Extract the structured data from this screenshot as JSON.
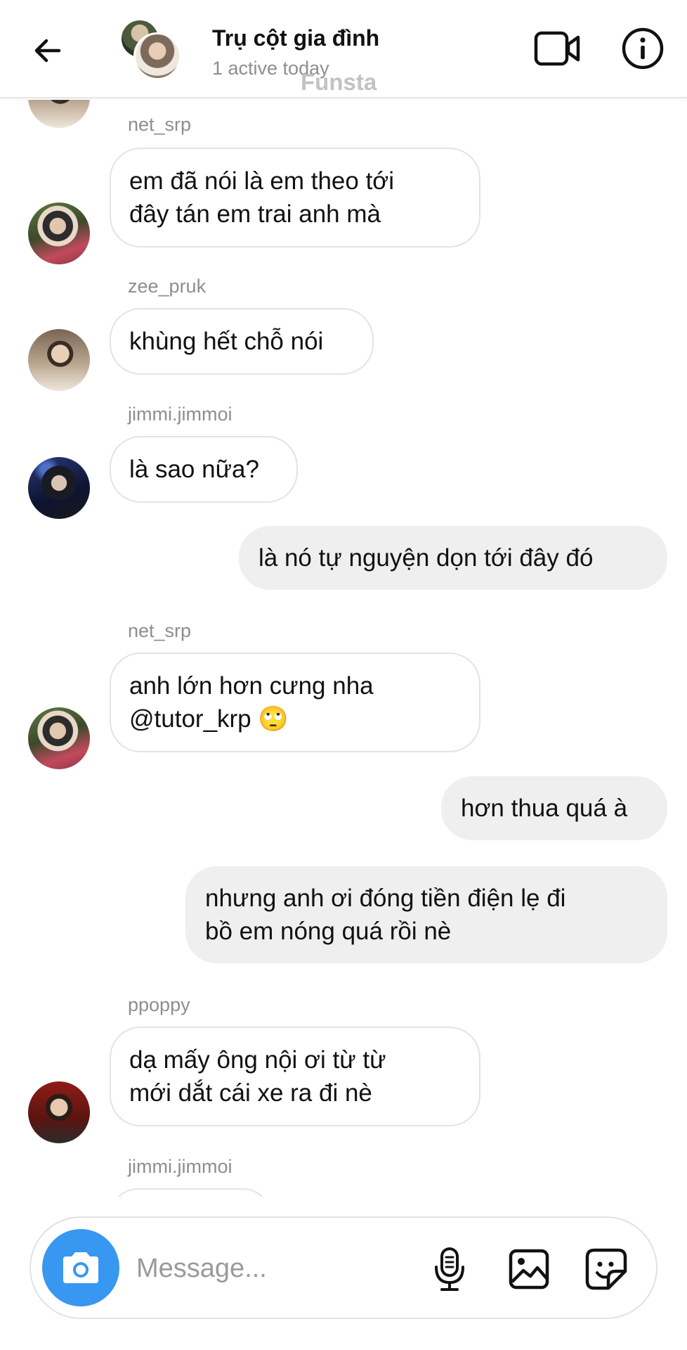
{
  "header": {
    "title": "Trụ cột gia đình",
    "status": "1 active today",
    "watermark": "Funsta",
    "icons": [
      "back-arrow-icon",
      "video-call-icon",
      "info-icon"
    ]
  },
  "messages": [
    {
      "direction": "in",
      "sender": "net_srp",
      "text": "em đã nói là em theo tới\nđây tán em trai anh mà",
      "avatar": "net_srp"
    },
    {
      "direction": "in",
      "sender": "zee_pruk",
      "text": "khùng hết chỗ nói",
      "avatar": "zee_pruk"
    },
    {
      "direction": "in",
      "sender": "jimmi.jimmoi",
      "text": "là sao nữa?",
      "avatar": "jimmi.jimmoi"
    },
    {
      "direction": "out",
      "text": "là nó tự nguyện dọn tới đây đó"
    },
    {
      "direction": "in",
      "sender": "net_srp",
      "text": "anh lớn hơn cưng nha\n@tutor_krp 🙄",
      "avatar": "net_srp"
    },
    {
      "direction": "out",
      "text": "hơn thua quá à"
    },
    {
      "direction": "out",
      "text": "nhưng anh ơi đóng tiền điện lẹ đi\nbồ em nóng quá rồi nè"
    },
    {
      "direction": "in",
      "sender": "ppoppy",
      "text": "dạ mấy ông nội ơi từ từ\nmới dắt cái xe ra đi nè",
      "avatar": "ppoppy"
    },
    {
      "direction": "in",
      "sender": "jimmi.jimmoi",
      "text": ""
    }
  ],
  "composer": {
    "placeholder": "Message...",
    "icons": [
      "camera-icon",
      "microphone-icon",
      "gallery-icon",
      "sticker-icon"
    ],
    "accent_color": "#3897f0"
  }
}
